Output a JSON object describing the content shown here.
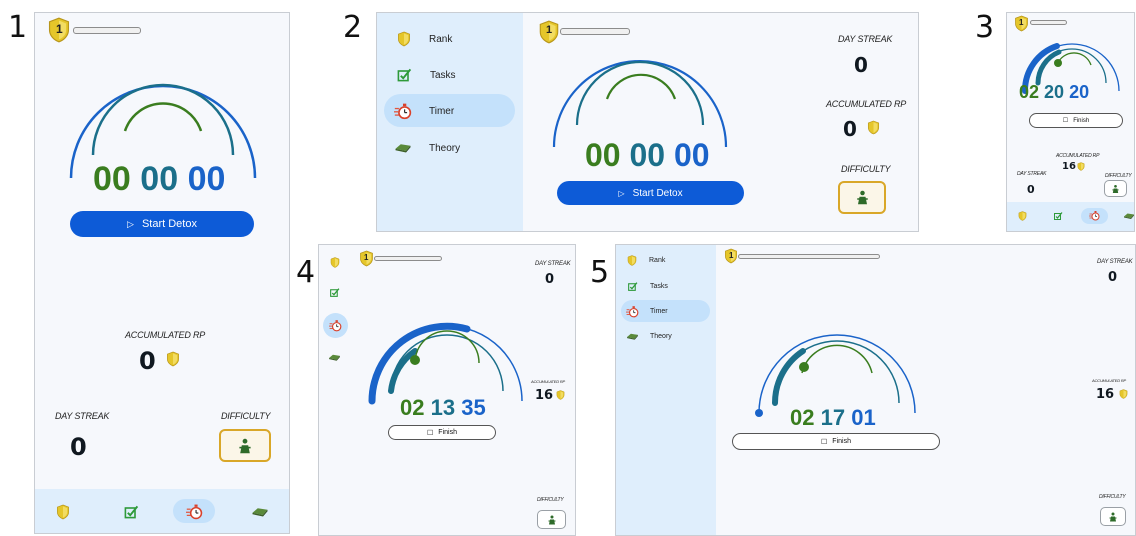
{
  "panel_numbers": [
    "1",
    "2",
    "3",
    "4",
    "5"
  ],
  "rank_level": "1",
  "labels": {
    "day_streak": "DAY STREAK",
    "accumulated_rp": "ACCUMULATED RP",
    "difficulty": "DIFFICULTY"
  },
  "nav": {
    "rank": "Rank",
    "tasks": "Tasks",
    "timer": "Timer",
    "theory": "Theory"
  },
  "buttons": {
    "start": "Start Detox",
    "finish": "Finish"
  },
  "panel1": {
    "h": "00",
    "m": "00",
    "s": "00",
    "accumulated_rp": "0",
    "day_streak": "0"
  },
  "panel2": {
    "h": "00",
    "m": "00",
    "s": "00",
    "accumulated_rp": "0",
    "day_streak": "0"
  },
  "panel3": {
    "h": "02",
    "m": "20",
    "s": "20",
    "accumulated_rp": "16",
    "day_streak": "0"
  },
  "panel4": {
    "h": "02",
    "m": "13",
    "s": "35",
    "accumulated_rp": "16",
    "day_streak": "0"
  },
  "panel5": {
    "h": "02",
    "m": "17",
    "s": "01",
    "accumulated_rp": "16",
    "day_streak": "0"
  },
  "colors": {
    "hours": "#3a7d1f",
    "minutes": "#1b6f8a",
    "seconds": "#1a63c9",
    "accent": "#0d5bd7",
    "nav_bg": "#dfeefc",
    "shield": "#e5c62a",
    "difficulty_border": "#d9a728"
  },
  "icons": {
    "rank": "shield-icon",
    "tasks": "checkbox-icon",
    "timer": "stopwatch-icon",
    "theory": "book-icon",
    "start": "play-icon",
    "finish": "stop-icon",
    "difficulty": "figure-icon"
  }
}
